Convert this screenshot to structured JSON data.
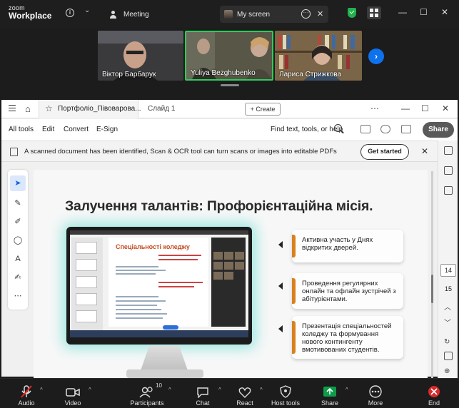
{
  "zoom": {
    "brand_line1": "zoom",
    "brand_line2": "Workplace",
    "tab_meeting": "Meeting",
    "tab_my_screen": "My screen",
    "shield_color": "#22b14c",
    "active_speaker_color": "#2fcc5a"
  },
  "participants_strip": [
    {
      "name": "Віктор Барбарук"
    },
    {
      "name": "Yuliya Bezghubenko"
    },
    {
      "name": "Лариса Стрижкова"
    }
  ],
  "acrobat": {
    "tab_title": "Портфоліо_Півоварова...",
    "tab2": "Слайд 1",
    "create_label": "Create",
    "menu": [
      "All tools",
      "Edit",
      "Convert",
      "E-Sign"
    ],
    "find_text": "Find text, tools, or help",
    "share_label": "Share",
    "banner_text": "A scanned document has been identified, Scan & OCR tool can turn scans or images into editable PDFs",
    "get_started": "Get started",
    "page_current": "14",
    "page_next": "15"
  },
  "slide": {
    "title": "Залучення талантів: Профорієнтаційна місія.",
    "inner_heading": "Спеціальності коледжу",
    "cards": [
      "Активна участь у Днях відкритих дверей.",
      "Проведення регулярних онлайн та офлайн зустрічей з абітурієнтами.",
      "Презентація спеціальностей коледжу та формування нового контингенту вмотивованих студентів."
    ],
    "accent_color": "#d9811d"
  },
  "controls": {
    "audio": "Audio",
    "video": "Video",
    "participants": "Participants",
    "participants_count": "10",
    "chat": "Chat",
    "react": "React",
    "host_tools": "Host tools",
    "share": "Share",
    "more": "More",
    "end": "End"
  }
}
